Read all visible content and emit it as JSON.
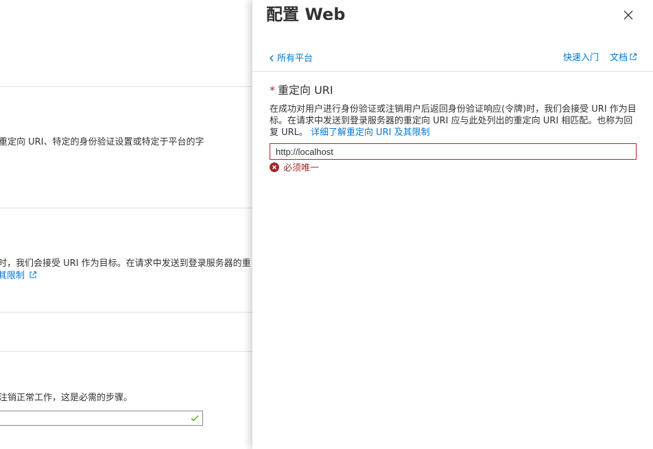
{
  "background": {
    "lines": [
      "重定向 URI、特定的身份验证设置或特定于平台的字",
      "时，我们会接受 URI 作为目标。在请求中发送到登录服务器的重",
      "注销正常工作，这是必需的步骤。"
    ],
    "link_text": "其限制"
  },
  "panel": {
    "title": "配置 Web",
    "back_label": "所有平台",
    "quickstart_label": "快速入门",
    "docs_label": "文档",
    "field": {
      "required_mark": "*",
      "label": "重定向 URI",
      "description": "在成功对用户进行身份验证或注销用户后返回身份验证响应(令牌)时，我们会接受 URI 作为目标。在请求中发送到登录服务器的重定向 URI 应与此处列出的重定向 URI 相匹配。也称为回复 URL。",
      "learn_more": "详细了解重定向 URI 及其限制",
      "value": "http://localhost",
      "error": "必须唯一"
    }
  },
  "colors": {
    "accent": "#0078d4",
    "error": "#a4262c",
    "success": "#57a300"
  },
  "icons": [
    "close-icon",
    "chevron-left-icon",
    "external-link-icon",
    "error-icon",
    "checkmark-icon"
  ]
}
